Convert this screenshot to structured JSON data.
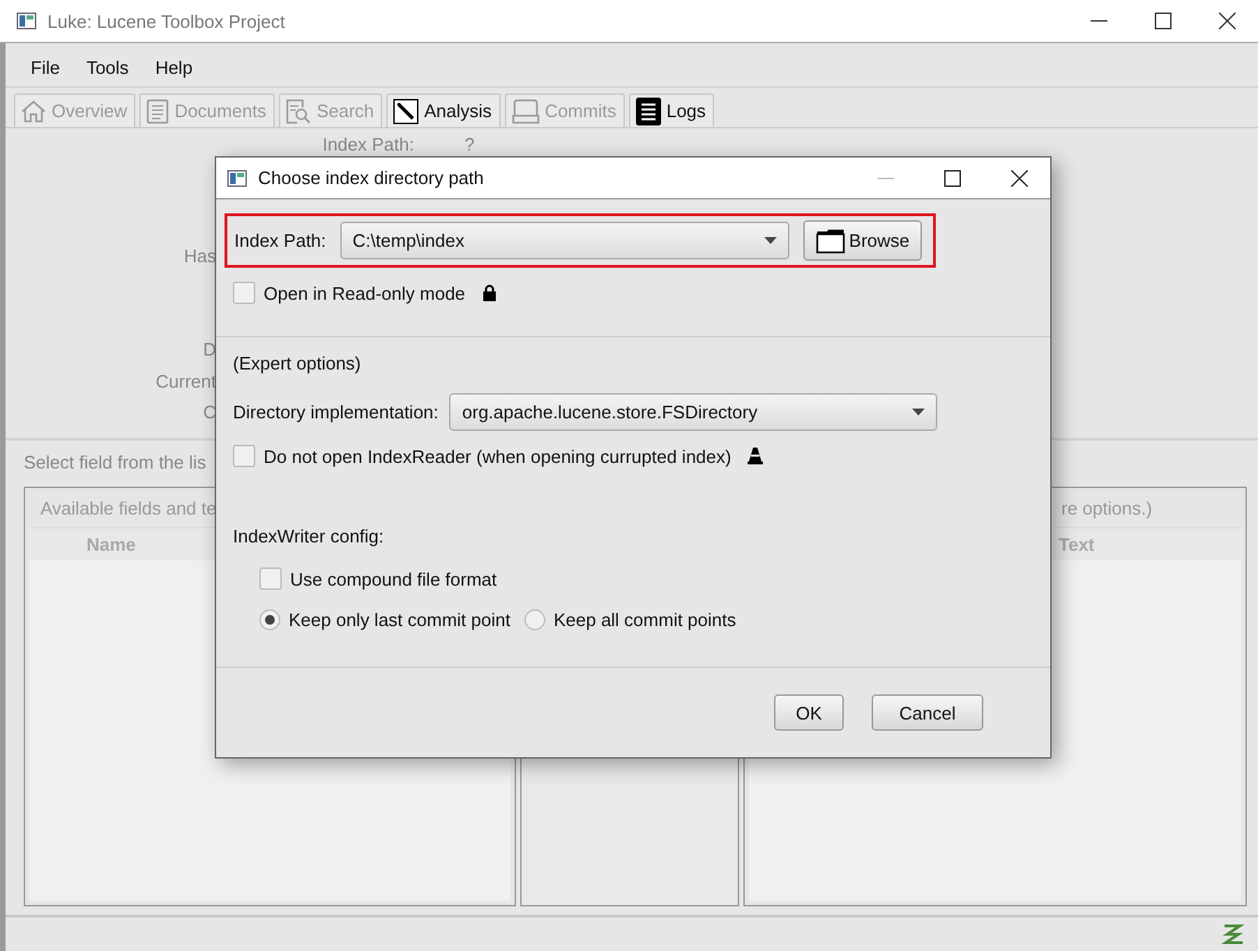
{
  "window": {
    "title": "Luke: Lucene Toolbox Project"
  },
  "menu": [
    "File",
    "Tools",
    "Help"
  ],
  "tabs": [
    {
      "label": "Overview",
      "kind": "home",
      "disabled": true
    },
    {
      "label": "Documents",
      "kind": "document",
      "disabled": true
    },
    {
      "label": "Search",
      "kind": "search",
      "disabled": true
    },
    {
      "label": "Analysis",
      "kind": "wand",
      "disabled": false
    },
    {
      "label": "Commits",
      "kind": "drive",
      "disabled": true
    },
    {
      "label": "Logs",
      "kind": "list",
      "disabled": false
    }
  ],
  "overview": {
    "index_path": {
      "label": "Index Path:",
      "value": "?"
    },
    "cut_labels": [
      "Has",
      "D",
      "Current",
      "C"
    ]
  },
  "analysis": {
    "hint": "Select field from the lis",
    "fields_panel": {
      "title": "Available fields and te",
      "columns": [
        "Name"
      ]
    },
    "right_panel": {
      "title": "re options.)",
      "columns": [
        "Text"
      ]
    }
  },
  "dialog": {
    "title": "Choose index directory path",
    "index_path": {
      "label": "Index Path:",
      "value": "C:\\temp\\index"
    },
    "browse_button": "Browse",
    "read_only": {
      "label": "Open in Read-only mode",
      "checked": false
    },
    "expert_title": "(Expert options)",
    "directory_impl": {
      "label": "Directory implementation:",
      "value": "org.apache.lucene.store.FSDirectory"
    },
    "no_reader": {
      "label": "Do not open IndexReader (when opening currupted index)",
      "checked": false
    },
    "writer_config_title": "IndexWriter config:",
    "compound": {
      "label": "Use compound file format",
      "checked": false
    },
    "commit_policy": [
      {
        "label": "Keep only last commit point",
        "selected": true
      },
      {
        "label": "Keep all commit points",
        "selected": false
      }
    ],
    "buttons": [
      "OK",
      "Cancel"
    ]
  }
}
